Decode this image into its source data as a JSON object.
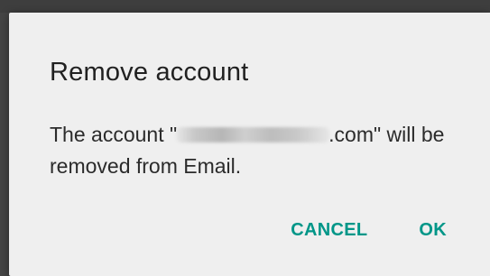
{
  "dialog": {
    "title": "Remove account",
    "message_prefix": "The account \"",
    "message_suffix": ".com\" will be removed from Email.",
    "cancel_label": "CANCEL",
    "ok_label": "OK"
  },
  "colors": {
    "accent": "#009688",
    "dialog_background": "#efefef",
    "scrim": "#454545",
    "title_text": "#212121",
    "body_text": "#2b2b2b"
  },
  "icons": {
    "redacted_email": "blurred-redaction"
  }
}
